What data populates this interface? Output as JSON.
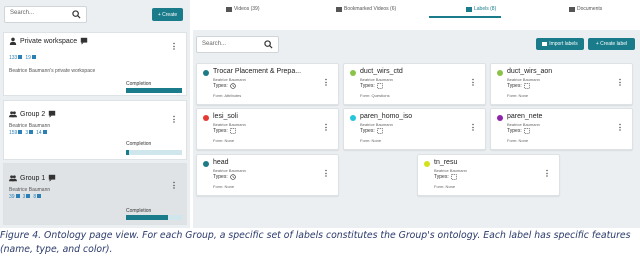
{
  "sidebar": {
    "search_placeholder": "Search...",
    "create_button": "+ Create",
    "groups": [
      {
        "title": "Private workspace",
        "owner": "Beatrice Baumann's private workspace",
        "count_a": "133",
        "count_b": "19",
        "completion_label": "Completion",
        "completion": 1.0
      },
      {
        "title": "Group 2",
        "owner": "Beatrice Baumann",
        "count_a": "159",
        "count_b": "3",
        "count_c": "14",
        "completion_label": "Completion",
        "completion": 0.06
      },
      {
        "title": "Group 1",
        "owner": "Beatrice Baumann",
        "count_a": "39",
        "count_b": "3",
        "count_c": "8",
        "completion_label": "Completion",
        "completion": 0.75
      }
    ]
  },
  "tabs": [
    {
      "label": "Videos (39)"
    },
    {
      "label": "Bookmarked Videos (6)"
    },
    {
      "label": "Labels (8)"
    },
    {
      "label": "Documents"
    }
  ],
  "labels_panel": {
    "search_placeholder": "Search...",
    "import_button": "Import labels",
    "create_button": "+ Create label",
    "labels": [
      {
        "name": "Trocar Placement & Prepa...",
        "owner": "Beatrice Baumann",
        "types_label": "Types:",
        "form": "Form:  Attributes",
        "color": "#1e7b86",
        "type_icon": "clock-icon"
      },
      {
        "name": "duct_wirs_ctd",
        "owner": "Beatrice Baumann",
        "types_label": "Types:",
        "form": "Form:  Questions",
        "color": "#8bc34a",
        "type_icon": "dashed-square-icon"
      },
      {
        "name": "duct_wirs_aon",
        "owner": "Beatrice Baumann",
        "types_label": "Types:",
        "form": "Form:  None",
        "color": "#8bc34a",
        "type_icon": "dashed-square-icon"
      },
      {
        "name": "lesi_soli",
        "owner": "Beatrice Baumann",
        "types_label": "Types:",
        "form": "Form:  None",
        "color": "#e53935",
        "type_icon": "dashed-square-icon"
      },
      {
        "name": "paren_homo_iso",
        "owner": "Beatrice Baumann",
        "types_label": "Types:",
        "form": "Form:  None",
        "color": "#26c6da",
        "type_icon": "dashed-square-icon"
      },
      {
        "name": "paren_nete",
        "owner": "Beatrice Baumann",
        "types_label": "Types:",
        "form": "Form:  None",
        "color": "#8e24aa",
        "type_icon": "dashed-square-icon"
      },
      {
        "name": "head",
        "owner": "Beatrice Baumann",
        "types_label": "Types:",
        "form": "Form:  None",
        "color": "#1e7b86",
        "type_icon": "clock-icon"
      },
      {
        "name": "tn_resu",
        "owner": "Beatrice Baumann",
        "types_label": "Types:",
        "form": "Form:  None",
        "color": "#d4e21c",
        "type_icon": "dashed-square-icon"
      }
    ]
  },
  "caption": "Figure 4. Ontology page view. For each Group, a specific set of labels constitutes the Group's ontology. Each label has specific features (name, type, and color)."
}
